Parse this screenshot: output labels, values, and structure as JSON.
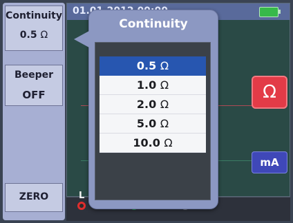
{
  "softkeys": {
    "continuity": {
      "label": "Continuity",
      "value": "0.5",
      "unit": "Ω"
    },
    "beeper": {
      "label": "Beeper",
      "value": "OFF"
    },
    "zero": {
      "label": "ZERO"
    }
  },
  "status": {
    "datetime": "01.01.2012 00:00"
  },
  "popup": {
    "title": "Continuity",
    "options": [
      {
        "value": "0.5",
        "unit": "Ω",
        "selected": true
      },
      {
        "value": "1.0",
        "unit": "Ω",
        "selected": false
      },
      {
        "value": "2.0",
        "unit": "Ω",
        "selected": false
      },
      {
        "value": "5.0",
        "unit": "Ω",
        "selected": false
      },
      {
        "value": "10.0",
        "unit": "Ω",
        "selected": false
      }
    ]
  },
  "function_buttons": {
    "ohm": "Ω",
    "ma": "mA"
  },
  "terminals": {
    "label": "L"
  },
  "colors": {
    "selected": "#2756b0",
    "ohm_button": "#e33b47",
    "ma_button": "#3f48b8"
  }
}
